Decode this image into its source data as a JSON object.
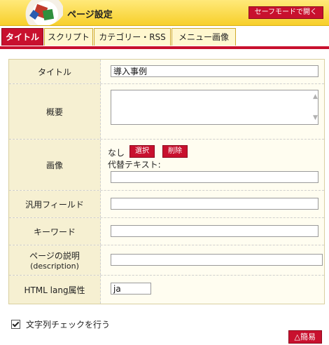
{
  "header": {
    "title": "ページ設定",
    "safe_mode_button": "セーフモードで開く"
  },
  "tabs": [
    {
      "label": "タイトル",
      "active": true
    },
    {
      "label": "スクリプト",
      "active": false
    },
    {
      "label": "カテゴリー・RSS",
      "active": false
    },
    {
      "label": "メニュー画像",
      "active": false
    }
  ],
  "form": {
    "title_label": "タイトル",
    "title_value": "導入事例",
    "summary_label": "概要",
    "summary_value": "",
    "image_label": "画像",
    "image_none": "なし",
    "image_select_button": "選択",
    "image_delete_button": "削除",
    "alt_text_label": "代替テキスト:",
    "alt_text_value": "",
    "general_field_label": "汎用フィールド",
    "general_field_value": "",
    "keyword_label": "キーワード",
    "keyword_value": "",
    "description_label": "ページの説明",
    "description_sublabel": "(description)",
    "description_value": "",
    "lang_label": "HTML lang属性",
    "lang_value": "ja"
  },
  "footer": {
    "string_check_label": "文字列チェックを行う",
    "string_check_checked": true,
    "simple_button": "△簡易"
  },
  "colors": {
    "accent_red": "#c8102e",
    "header_yellow": "#f7cf2a"
  }
}
